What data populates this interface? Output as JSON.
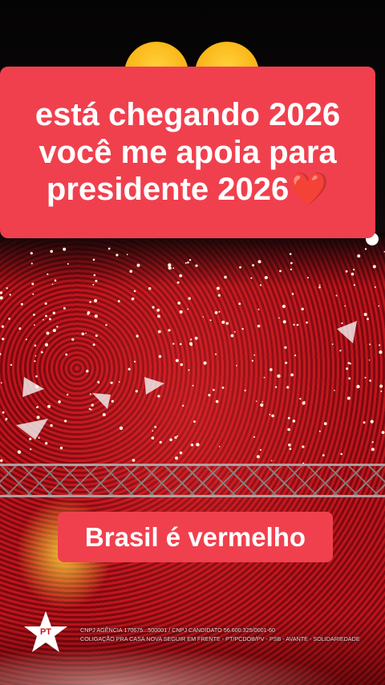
{
  "headline": {
    "line1": "está chegando 2026",
    "line2": "você me apoia para",
    "line3": "presidente 2026",
    "heart": "❤️"
  },
  "tagline": "Brasil é vermelho",
  "logo": {
    "text": "PT",
    "icon": "star-icon"
  },
  "legal": {
    "line1": "CNPJ AGÊNCIA 170675...500001 / CNPJ CANDIDATO 56.600.325/0001-60",
    "line2": "COLIGAÇÃO PRA CASA NOVA SEGUIR EM FRENTE - PT/PCDOB/PV - PSB - AVANTE - SOLIDARIEDADE"
  },
  "colors": {
    "caption_bg": "#f0404e",
    "crowd_red": "#c0141c",
    "logo_red": "#d0101a"
  }
}
